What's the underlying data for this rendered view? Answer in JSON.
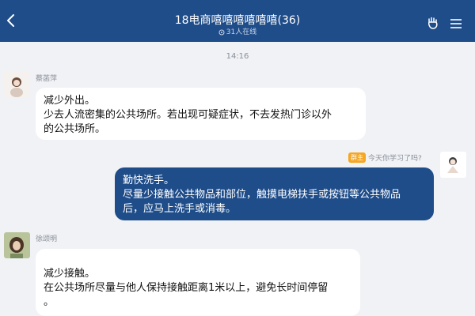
{
  "header": {
    "title": "18电商嘻嘻嘻嘻嘻嘻(36)",
    "online": "31人在线",
    "colors": {
      "bar": "#1f4d8a"
    }
  },
  "chat": {
    "time": "14:16",
    "messages": [
      {
        "side": "left",
        "sender": "蔡菡萍",
        "lines": [
          "减少外出。",
          "少去人流密集的公共场所。若出现可疑症状，不去发热门诊以外",
          "的公共场所。"
        ]
      },
      {
        "side": "right",
        "badge": "群主",
        "sender": "今天你学习了吗?",
        "lines": [
          "勤快洗手。",
          "尽量少接触公共物品和部位，触摸电梯扶手或按钮等公共物品",
          "后，应马上洗手或消毒。"
        ]
      },
      {
        "side": "left",
        "sender": "徐颂明",
        "lines": [
          "减少接触。",
          "在公共场所尽量与他人保持接触距离1米以上，避免长时间停留",
          "。"
        ]
      }
    ]
  },
  "icons": {
    "back": "chevron-left-icon",
    "gesture": "hand-gesture-icon",
    "menu": "menu-icon",
    "online": "online-indicator-icon"
  }
}
